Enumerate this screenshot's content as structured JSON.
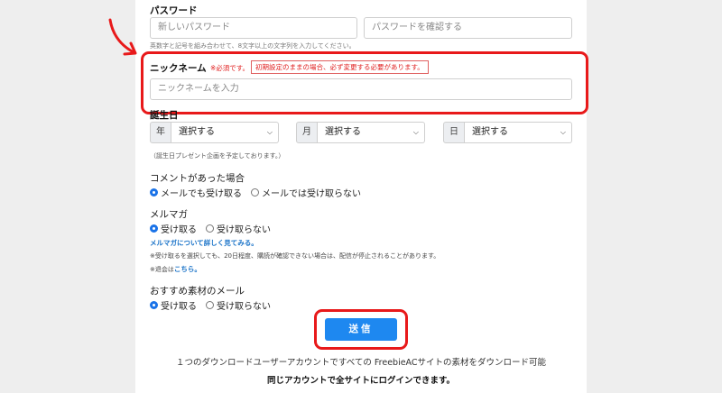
{
  "password": {
    "label": "パスワード",
    "new_placeholder": "新しいパスワード",
    "confirm_placeholder": "パスワードを確認する",
    "hint": "英数字と記号を組み合わせて、8文字以上の文字列を入力してください。"
  },
  "nickname": {
    "label": "ニックネーム",
    "required": "※必須です。",
    "notice": "初期設定のままの場合、必ず変更する必要があります。",
    "placeholder": "ニックネームを入力"
  },
  "birthday": {
    "label": "誕生日",
    "year_prefix": "年",
    "month_prefix": "月",
    "day_prefix": "日",
    "select_value": "選択する",
    "hint": "（誕生日プレゼント企画を予定しております。）"
  },
  "comment": {
    "label": "コメントがあった場合",
    "option_yes": "メールでも受け取る",
    "option_no": "メールでは受け取らない"
  },
  "magazine": {
    "label": "メルマガ",
    "option_yes": "受け取る",
    "option_no": "受け取らない",
    "link": "メルマガについて詳しく見てみる。",
    "note": "※受け取るを選択しても、20日程度、購読が確認できない場合は、配信が停止されることがあります。",
    "unsub_prefix": "※退会は",
    "unsub_link": "こちら。"
  },
  "recommend": {
    "label": "おすすめ素材のメール",
    "option_yes": "受け取る",
    "option_no": "受け取らない"
  },
  "submit_label": "送信",
  "footer": {
    "line1": "１つのダウンロードユーザーアカウントですべての FreebieACサイトの素材をダウンロード可能",
    "line2": "同じアカウントで全サイトにログインできます。"
  },
  "icons": {
    "arrow": "red-arrow-icon",
    "chevron": "chevron-down-icon"
  },
  "colors": {
    "highlight": "#e8191a",
    "primary": "#1e88f0",
    "link": "#1a73c8"
  }
}
